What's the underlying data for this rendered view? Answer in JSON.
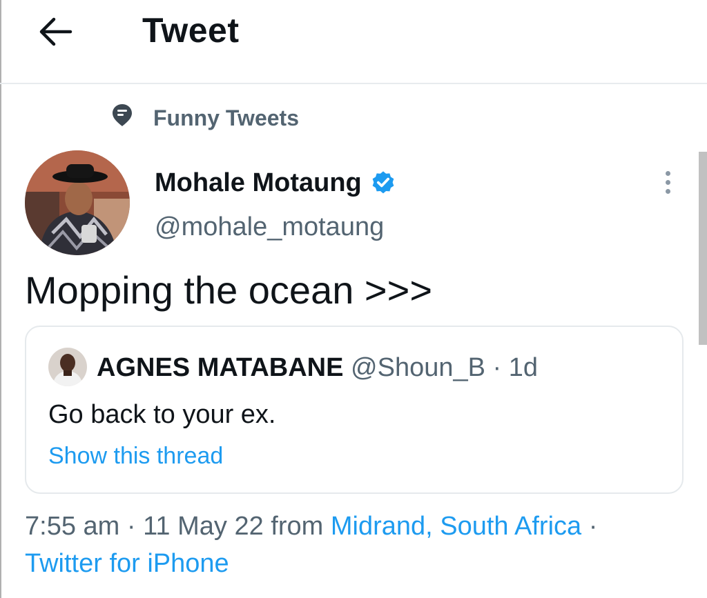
{
  "header": {
    "back_icon": "arrow-left-icon",
    "title": "Tweet"
  },
  "context": {
    "icon": "pin-icon",
    "label": "Funny Tweets"
  },
  "tweet": {
    "author_name": "Mohale Motaung",
    "verified_icon": "verified-badge-icon",
    "author_handle": "@mohale_motaung",
    "more_icon": "more-vertical-icon",
    "text": "Mopping the ocean >>>",
    "quote": {
      "author_name": "AGNES MATABANE",
      "author_handle": "@Shoun_B",
      "separator": "·",
      "time": "1d",
      "text": "Go back to your ex.",
      "link": "Show this thread"
    },
    "meta": {
      "time": "7:55 am",
      "sep1": "·",
      "date": "11 May 22",
      "from": "from",
      "location": "Midrand, South Africa",
      "sep2": "·",
      "client": "Twitter for iPhone"
    }
  },
  "colors": {
    "accent": "#1d9bf0",
    "text": "#0f1419",
    "secondary": "#536471",
    "border": "#e5e9ec"
  }
}
